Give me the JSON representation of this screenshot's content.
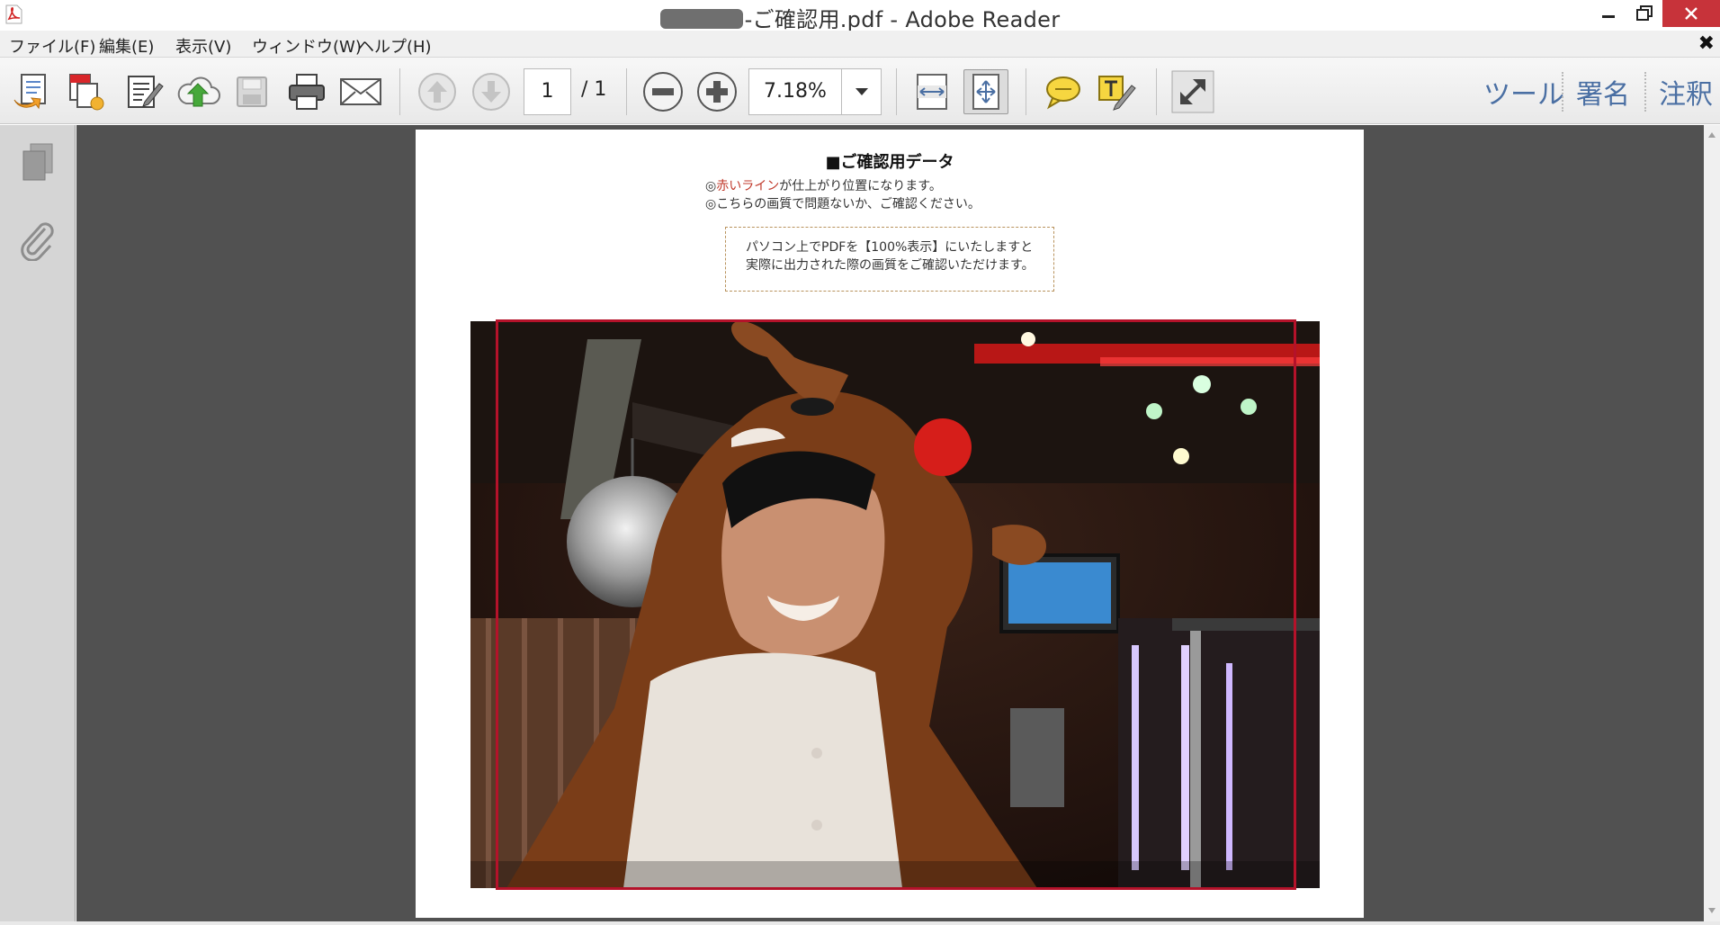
{
  "window": {
    "title": "-ご確認用.pdf - Adobe Reader"
  },
  "menu": {
    "items": [
      "ファイル(F)",
      "編集(E)",
      "表示(V)",
      "ウィンドウ(W)",
      "ヘルプ(H)"
    ]
  },
  "toolbar": {
    "page_current": "1",
    "page_total": "/ 1",
    "zoom": "7.18%",
    "panels": [
      "ツール",
      "署名",
      "注釈"
    ]
  },
  "document": {
    "heading": "■ご確認用データ",
    "note1_red": "赤いライン",
    "note1_prefix": "◎",
    "note1_suffix": "が仕上がり位置になります。",
    "note2": "◎こちらの画質で問題ないか、ご確認ください。",
    "box_line1": "パソコン上でPDFを【100%表示】にいたしますと",
    "box_line2": "実際に出力された際の画質をご確認いただけます。"
  },
  "colors": {
    "trim_line": "#b4122a",
    "close_button": "#c7333a",
    "panel_links": "#4a6fa3"
  }
}
